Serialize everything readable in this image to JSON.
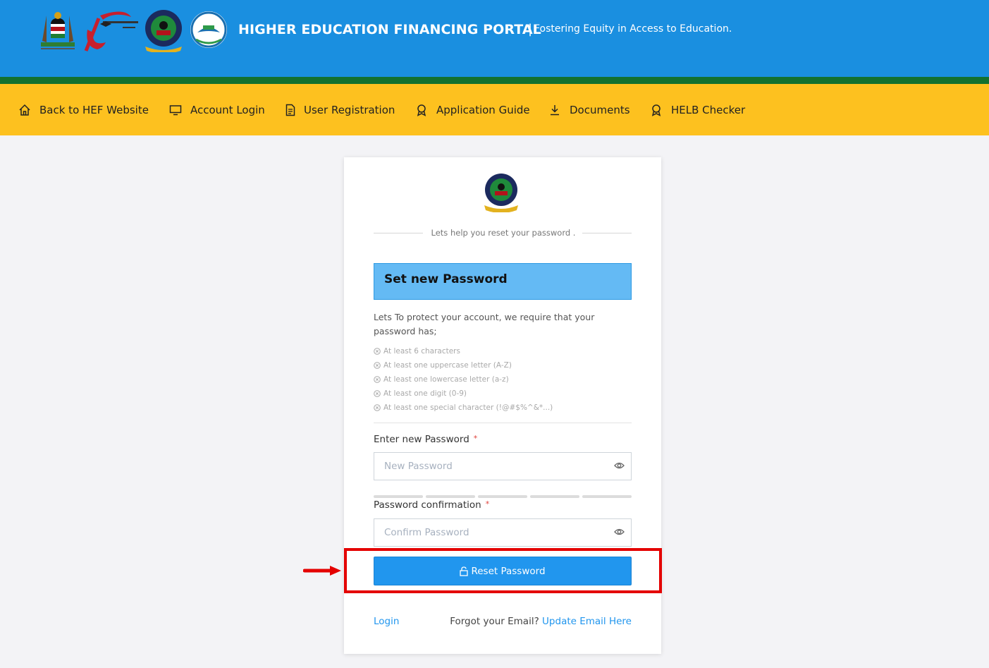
{
  "header": {
    "title": "HIGHER EDUCATION FINANCING PORTAL",
    "separator": "|",
    "tagline": "Fostering Equity in Access to Education.",
    "logos": [
      "kenya-coat-of-arms",
      "university-fund-logo",
      "helb-logo",
      "kuccps-logo"
    ]
  },
  "nav": {
    "items": [
      {
        "label": "Back to HEF Website",
        "icon": "home-icon"
      },
      {
        "label": "Account Login",
        "icon": "monitor-icon"
      },
      {
        "label": "User Registration",
        "icon": "document-icon"
      },
      {
        "label": "Application Guide",
        "icon": "award-icon"
      },
      {
        "label": "Documents",
        "icon": "download-icon"
      },
      {
        "label": "HELB Checker",
        "icon": "award-icon"
      }
    ]
  },
  "card": {
    "divider_text": "Lets help you reset your password .",
    "heading": "Set new Password",
    "intro": "Lets To protect your account, we require that your password has;",
    "requirements": [
      "At least 6 characters",
      "At least one uppercase letter (A-Z)",
      "At least one lowercase letter (a-z)",
      "At least one digit (0-9)",
      "At least one special character (!@#$%^&*...)"
    ],
    "new_password": {
      "label": "Enter new Password",
      "required_mark": "*",
      "placeholder": "New Password",
      "value": ""
    },
    "confirm_password": {
      "label": "Password confirmation",
      "required_mark": "*",
      "placeholder": "Confirm Password",
      "value": ""
    },
    "strength_segments": 5,
    "reset_button": "Reset Password",
    "login_link": "Login",
    "forgot_text": "Forgot your Email?",
    "update_email_link": "Update Email Here"
  },
  "colors": {
    "topbar": "#1a8fe0",
    "green_stripe": "#13712f",
    "navbar": "#fdc11f",
    "primary": "#2196ee",
    "heading_box": "#64baf4",
    "annotation": "#e40000"
  }
}
